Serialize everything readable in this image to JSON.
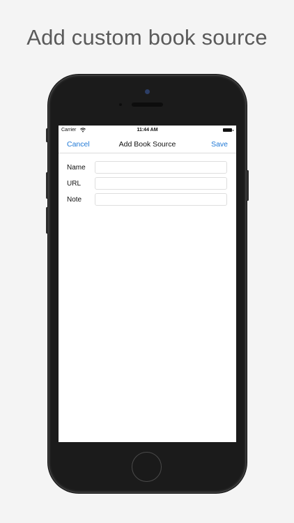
{
  "headline": "Add custom book source",
  "status_bar": {
    "carrier": "Carrier",
    "wifi_icon": "wifi-icon",
    "time": "11:44 AM",
    "battery_icon": "battery-icon"
  },
  "nav_bar": {
    "cancel_label": "Cancel",
    "title": "Add Book Source",
    "save_label": "Save",
    "accent_color": "#2079d6"
  },
  "form": {
    "fields": [
      {
        "label": "Name",
        "value": "",
        "placeholder": ""
      },
      {
        "label": "URL",
        "value": "",
        "placeholder": ""
      },
      {
        "label": "Note",
        "value": "",
        "placeholder": ""
      }
    ]
  }
}
